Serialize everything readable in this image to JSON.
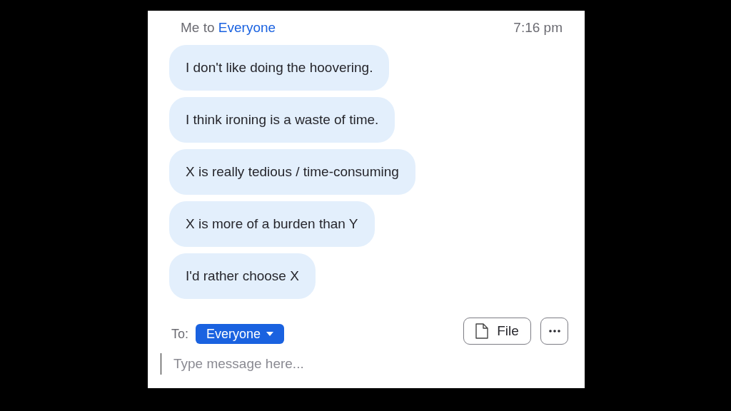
{
  "header": {
    "sender": "Me",
    "connector": "to",
    "recipient": "Everyone",
    "time": "7:16 pm"
  },
  "messages": [
    {
      "text": "I don't like doing the hoovering."
    },
    {
      "text": "I think ironing is a waste of time."
    },
    {
      "text": "X is really tedious / time-consuming"
    },
    {
      "text": "X is more of a burden than Y"
    },
    {
      "text": "I'd rather choose X"
    }
  ],
  "composer": {
    "to_label": "To:",
    "recipient": "Everyone",
    "file_button": "File",
    "placeholder": "Type message here..."
  }
}
